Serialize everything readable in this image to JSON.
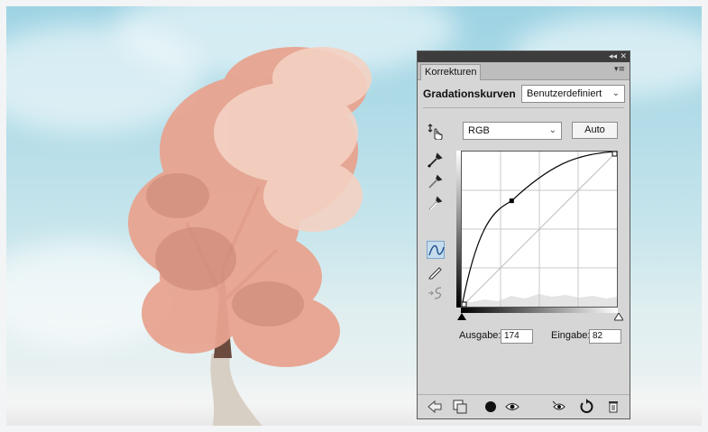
{
  "panel": {
    "tab_label": "Korrekturen",
    "adjustment_title": "Gradationskurven",
    "preset_value": "Benutzerdefiniert",
    "channel_value": "RGB",
    "auto_label": "Auto",
    "output_label": "Ausgabe:",
    "output_value": "174",
    "input_label": "Eingabe:",
    "input_value": "82",
    "collapse_glyph": "◂◂",
    "close_glyph": "✕",
    "menu_glyph": "▾≡"
  },
  "curve": {
    "input": 82,
    "output": 174,
    "range": [
      0,
      255
    ]
  },
  "icons": {
    "left_tools": [
      "on-image-adjust-icon",
      "black-point-eyedropper-icon",
      "gray-point-eyedropper-icon",
      "white-point-eyedropper-icon",
      "curve-edit-icon",
      "pencil-draw-icon",
      "smooth-curve-icon"
    ],
    "bottom_tools": [
      "back-arrow-icon",
      "clip-to-layer-icon",
      "layer-mask-icon",
      "visibility-eye-icon",
      "previous-state-icon",
      "reset-icon",
      "trash-icon"
    ]
  }
}
